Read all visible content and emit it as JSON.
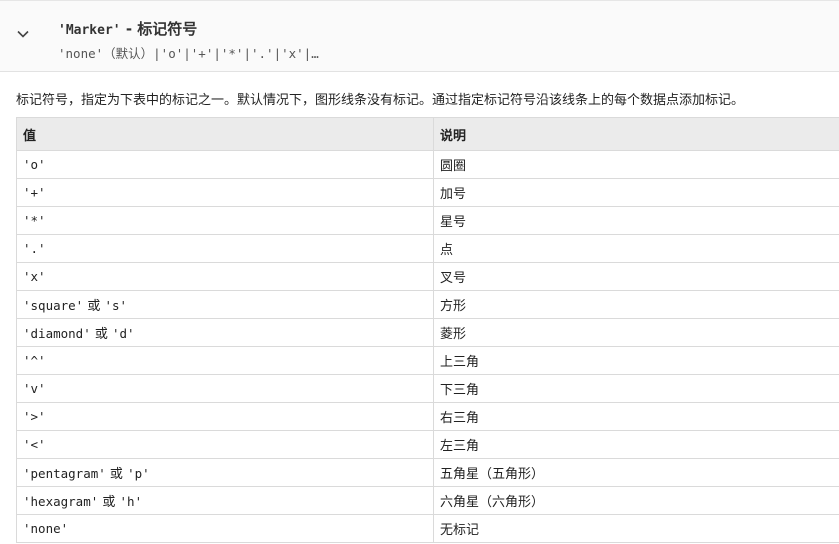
{
  "section": {
    "title_code": "'Marker'",
    "title_text": " - 标记符号",
    "signature": "'none'（默认）|'o'|'+'|'*'|'.'|'x'|…"
  },
  "description": "标记符号，指定为下表中的标记之一。默认情况下，图形线条没有标记。通过指定标记符号沿该线条上的每个数据点添加标记。",
  "table": {
    "headers": [
      "值",
      "说明"
    ],
    "rows": [
      {
        "value_parts": [
          "'o'"
        ],
        "desc": "圆圈"
      },
      {
        "value_parts": [
          "'+'"
        ],
        "desc": "加号"
      },
      {
        "value_parts": [
          "'*'"
        ],
        "desc": "星号"
      },
      {
        "value_parts": [
          "'.'"
        ],
        "desc": "点"
      },
      {
        "value_parts": [
          "'x'"
        ],
        "desc": "叉号"
      },
      {
        "value_parts": [
          "'square'",
          " 或 ",
          "'s'"
        ],
        "desc": "方形"
      },
      {
        "value_parts": [
          "'diamond'",
          " 或 ",
          "'d'"
        ],
        "desc": "菱形"
      },
      {
        "value_parts": [
          "'^'"
        ],
        "desc": "上三角"
      },
      {
        "value_parts": [
          "'v'"
        ],
        "desc": "下三角"
      },
      {
        "value_parts": [
          "'>'"
        ],
        "desc": "右三角"
      },
      {
        "value_parts": [
          "'<'"
        ],
        "desc": "左三角"
      },
      {
        "value_parts": [
          "'pentagram'",
          " 或 ",
          "'p'"
        ],
        "desc": "五角星（五角形）"
      },
      {
        "value_parts": [
          "'hexagram'",
          " 或 ",
          "'h'"
        ],
        "desc": "六角星（六角形）"
      },
      {
        "value_parts": [
          "'none'"
        ],
        "desc": "无标记"
      }
    ]
  }
}
